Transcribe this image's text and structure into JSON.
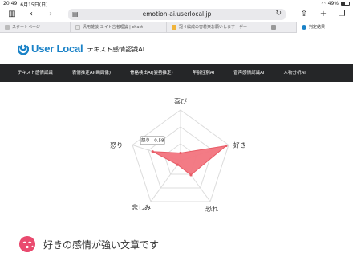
{
  "status": {
    "time": "20:49",
    "date": "6月15日(日)",
    "battery": "49%",
    "battery_level": 0.49
  },
  "browser": {
    "url": "emotion-ai.userlocal.jp",
    "tabs": [
      {
        "label": "スタートページ",
        "icon": "star-icon",
        "active": false
      },
      {
        "label": "汎用雑談 エイト言者理論 | chact",
        "icon": "page-icon",
        "active": false
      },
      {
        "label": "冠４編成の容着楽お願いします・ゲー",
        "icon": "bookmark-icon",
        "active": false
      },
      {
        "label": "",
        "icon": "tab-icon",
        "active": false
      },
      {
        "label": "判定結果",
        "icon": "userlocal-icon",
        "active": true
      }
    ]
  },
  "site": {
    "brand": "User Local",
    "product": "テキスト感情認識AI"
  },
  "nav": {
    "items": [
      "テキスト感情認識",
      "表情推定AI(画面像)",
      "骨格検出AI(姿勢推定)",
      "年齢性別AI",
      "音声感情認識AI",
      "人物分析AI"
    ]
  },
  "chart_data": {
    "type": "radar",
    "axes": [
      "喜び",
      "好き",
      "恐れ",
      "悲しみ",
      "怒り"
    ],
    "values": [
      0.15,
      0.95,
      0.35,
      0.1,
      0.58
    ],
    "range": [
      0,
      1
    ],
    "tooltip": {
      "label": "怒り",
      "value": "0.58"
    },
    "colors": {
      "fill": "#f2747e",
      "stroke": "#e85b66",
      "grid": "#dcdcdc"
    }
  },
  "result": {
    "heading": "好きの感情が強い文章です",
    "icon": "kiss-face-icon"
  }
}
